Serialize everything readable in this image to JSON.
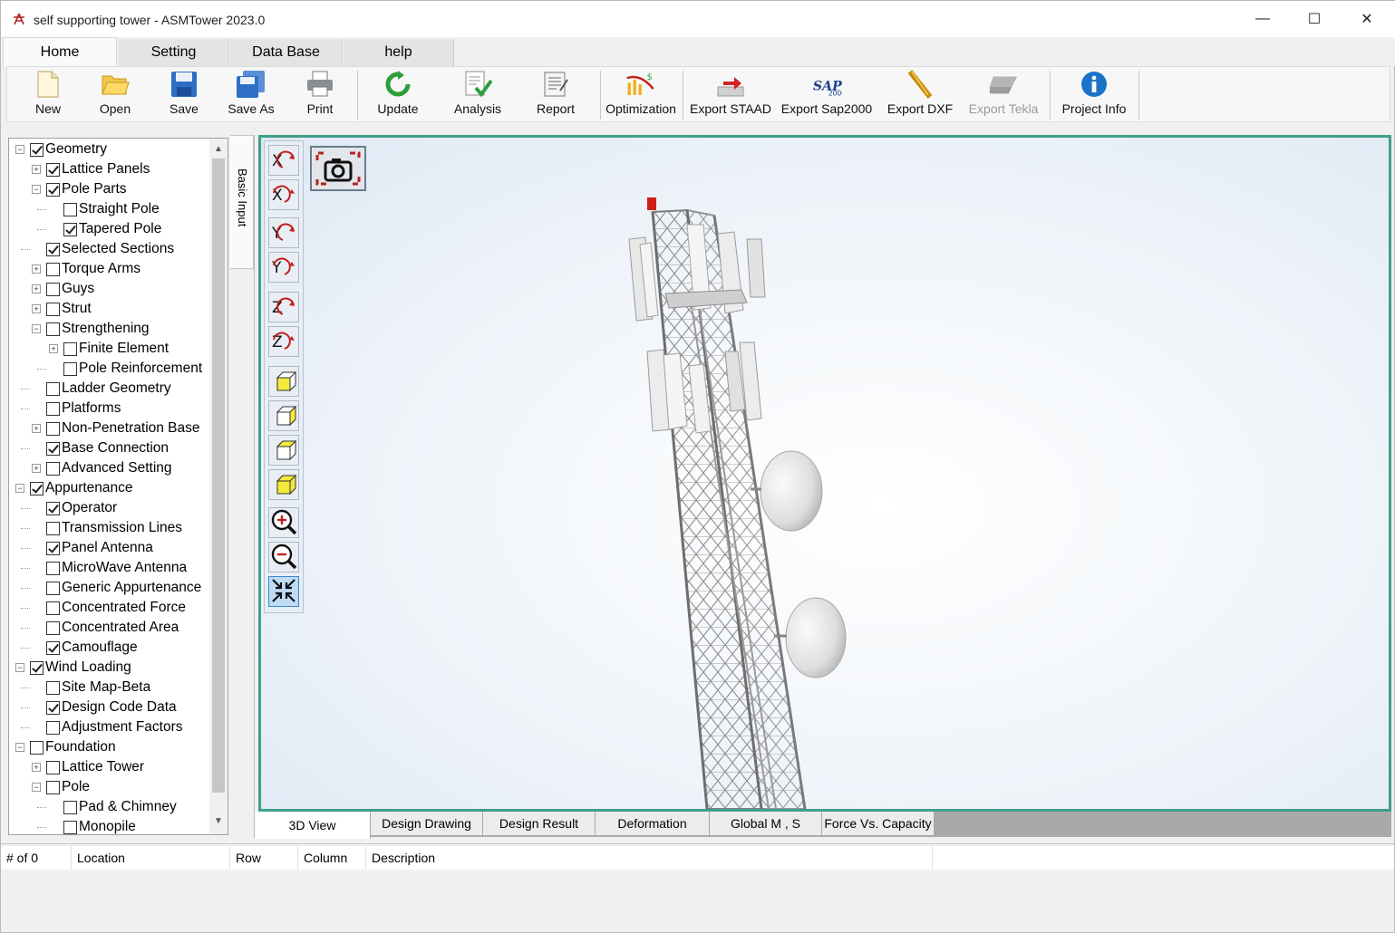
{
  "window": {
    "title": "self supporting tower  - ASMTower 2023.0",
    "minimize": "—",
    "maximize": "☐",
    "close": "✕"
  },
  "ribbon_tabs": [
    {
      "label": "Home",
      "active": true
    },
    {
      "label": "Setting",
      "active": false
    },
    {
      "label": "Data Base",
      "active": false
    },
    {
      "label": "help",
      "active": false
    }
  ],
  "toolbar": {
    "new": "New",
    "open": "Open",
    "save": "Save",
    "save_as": "Save As",
    "print": "Print",
    "update": "Update",
    "analysis": "Analysis",
    "report": "Report",
    "optimization": "Optimization",
    "export_staad": "Export STAAD",
    "export_sap2000": "Export Sap2000",
    "export_dxf": "Export DXF",
    "export_tekla": "Export Tekla",
    "project_info": "Project Info"
  },
  "tree": [
    {
      "label": "Geometry",
      "checked": true,
      "level": 0,
      "expander": "-"
    },
    {
      "label": "Lattice Panels",
      "checked": true,
      "level": 1,
      "expander": "+"
    },
    {
      "label": "Pole Parts",
      "checked": true,
      "level": 1,
      "expander": "-"
    },
    {
      "label": "Straight Pole",
      "checked": false,
      "level": 2,
      "expander": ""
    },
    {
      "label": "Tapered Pole",
      "checked": true,
      "level": 2,
      "expander": ""
    },
    {
      "label": "Selected Sections",
      "checked": true,
      "level": 1,
      "expander": ""
    },
    {
      "label": "Torque Arms",
      "checked": false,
      "level": 1,
      "expander": "+"
    },
    {
      "label": "Guys",
      "checked": false,
      "level": 1,
      "expander": "+"
    },
    {
      "label": "Strut",
      "checked": false,
      "level": 1,
      "expander": "+"
    },
    {
      "label": "Strengthening",
      "checked": false,
      "level": 1,
      "expander": "-"
    },
    {
      "label": "Finite Element",
      "checked": false,
      "level": 2,
      "expander": "+"
    },
    {
      "label": "Pole Reinforcement",
      "checked": false,
      "level": 2,
      "expander": ""
    },
    {
      "label": "Ladder Geometry",
      "checked": false,
      "level": 1,
      "expander": ""
    },
    {
      "label": "Platforms",
      "checked": false,
      "level": 1,
      "expander": ""
    },
    {
      "label": "Non-Penetration Base",
      "checked": false,
      "level": 1,
      "expander": "+"
    },
    {
      "label": "Base Connection",
      "checked": true,
      "level": 1,
      "expander": ""
    },
    {
      "label": "Advanced Setting",
      "checked": false,
      "level": 1,
      "expander": "+"
    },
    {
      "label": "Appurtenance",
      "checked": true,
      "level": 0,
      "expander": "-"
    },
    {
      "label": "Operator",
      "checked": true,
      "level": 1,
      "expander": ""
    },
    {
      "label": "Transmission Lines",
      "checked": false,
      "level": 1,
      "expander": ""
    },
    {
      "label": "Panel Antenna",
      "checked": true,
      "level": 1,
      "expander": ""
    },
    {
      "label": "MicroWave Antenna",
      "checked": false,
      "level": 1,
      "expander": ""
    },
    {
      "label": "Generic Appurtenance",
      "checked": false,
      "level": 1,
      "expander": ""
    },
    {
      "label": "Concentrated Force",
      "checked": false,
      "level": 1,
      "expander": ""
    },
    {
      "label": "Concentrated Area",
      "checked": false,
      "level": 1,
      "expander": ""
    },
    {
      "label": "Camouflage",
      "checked": true,
      "level": 1,
      "expander": ""
    },
    {
      "label": "Wind Loading",
      "checked": true,
      "level": 0,
      "expander": "-"
    },
    {
      "label": "Site Map-Beta",
      "checked": false,
      "level": 1,
      "expander": ""
    },
    {
      "label": "Design Code Data",
      "checked": true,
      "level": 1,
      "expander": ""
    },
    {
      "label": "Adjustment Factors",
      "checked": false,
      "level": 1,
      "expander": ""
    },
    {
      "label": "Foundation",
      "checked": false,
      "level": 0,
      "expander": "-"
    },
    {
      "label": "Lattice Tower",
      "checked": false,
      "level": 1,
      "expander": "+"
    },
    {
      "label": "Pole",
      "checked": false,
      "level": 1,
      "expander": "-"
    },
    {
      "label": "Pad & Chimney",
      "checked": false,
      "level": 2,
      "expander": ""
    },
    {
      "label": "Monopile",
      "checked": false,
      "level": 2,
      "expander": ""
    }
  ],
  "side_tab": {
    "label": "Basic Input"
  },
  "view_tools": [
    {
      "name": "rotate-x-positive-icon"
    },
    {
      "name": "rotate-x-negative-icon"
    },
    {
      "name": "rotate-y-positive-icon"
    },
    {
      "name": "rotate-y-negative-icon"
    },
    {
      "name": "rotate-z-positive-icon"
    },
    {
      "name": "rotate-z-negative-icon"
    },
    {
      "name": "view-front-icon"
    },
    {
      "name": "view-side-icon"
    },
    {
      "name": "view-top-icon"
    },
    {
      "name": "view-iso-icon"
    },
    {
      "name": "zoom-in-icon"
    },
    {
      "name": "zoom-out-icon"
    },
    {
      "name": "fit-view-icon"
    }
  ],
  "bottom_tabs": [
    {
      "label": "3D View",
      "active": true
    },
    {
      "label": "Design Drawing",
      "active": false
    },
    {
      "label": "Design Result",
      "active": false
    },
    {
      "label": "Deformation",
      "active": false
    },
    {
      "label": "Global M , S",
      "active": false
    },
    {
      "label": "Force Vs. Capacity",
      "active": false
    }
  ],
  "messages": {
    "count": "# of 0",
    "location": "Location",
    "row": "Row",
    "column": "Column",
    "description": "Description"
  },
  "colors": {
    "viewport_border": "#3f9f8a",
    "accent_blue": "#1a73c9",
    "update_green": "#2e9e3a"
  }
}
